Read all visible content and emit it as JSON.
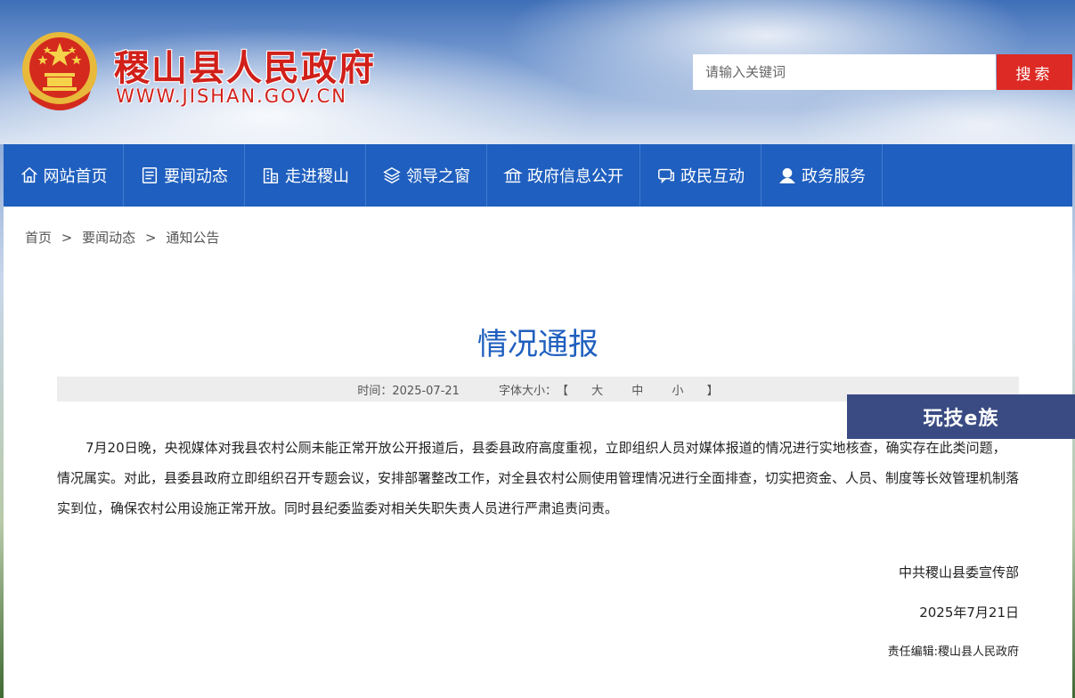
{
  "header": {
    "site_name": "稷山县人民政府",
    "site_url": "WWW.JISHAN.GOV.CN",
    "search_placeholder": "请输入关键词",
    "search_button": "搜索"
  },
  "nav": {
    "items": [
      {
        "label": "网站首页",
        "icon": "home-icon"
      },
      {
        "label": "要闻动态",
        "icon": "news-icon"
      },
      {
        "label": "走进稷山",
        "icon": "building-icon"
      },
      {
        "label": "领导之窗",
        "icon": "layers-icon"
      },
      {
        "label": "政府信息公开",
        "icon": "government-building-icon"
      },
      {
        "label": "政民互动",
        "icon": "chat-icon"
      },
      {
        "label": "政务服务",
        "icon": "user-service-icon"
      }
    ]
  },
  "breadcrumb": {
    "items": [
      "首页",
      "要闻动态",
      "通知公告"
    ],
    "separator": ">"
  },
  "article": {
    "title": "情况通报",
    "time_label": "时间：2025-07-21",
    "font_size_label": "字体大小：",
    "bracket_open": "【",
    "bracket_close": "】",
    "font_sizes": [
      "大",
      "中",
      "小"
    ],
    "body": "7月20日晚，央视媒体对我县农村公厕未能正常开放公开报道后，县委县政府高度重视，立即组织人员对媒体报道的情况进行实地核查，确实存在此类问题，情况属实。对此，县委县政府立即组织召开专题会议，安排部署整改工作，对全县农村公厕使用管理情况进行全面排查，切实把资金、人员、制度等长效管理机制落实到位，确保农村公用设施正常开放。同时县纪委监委对相关失职失责人员进行严肃追责问责。",
    "signer": "中共稷山县委宣传部",
    "sign_date": "2025年7月21日",
    "editor": "责任编辑:稷山县人民政府"
  },
  "watermark": {
    "text": "玩技e族"
  },
  "colors": {
    "brand_red": "#d1201a",
    "nav_blue": "#1f5fbf",
    "search_red": "#de2a24"
  }
}
